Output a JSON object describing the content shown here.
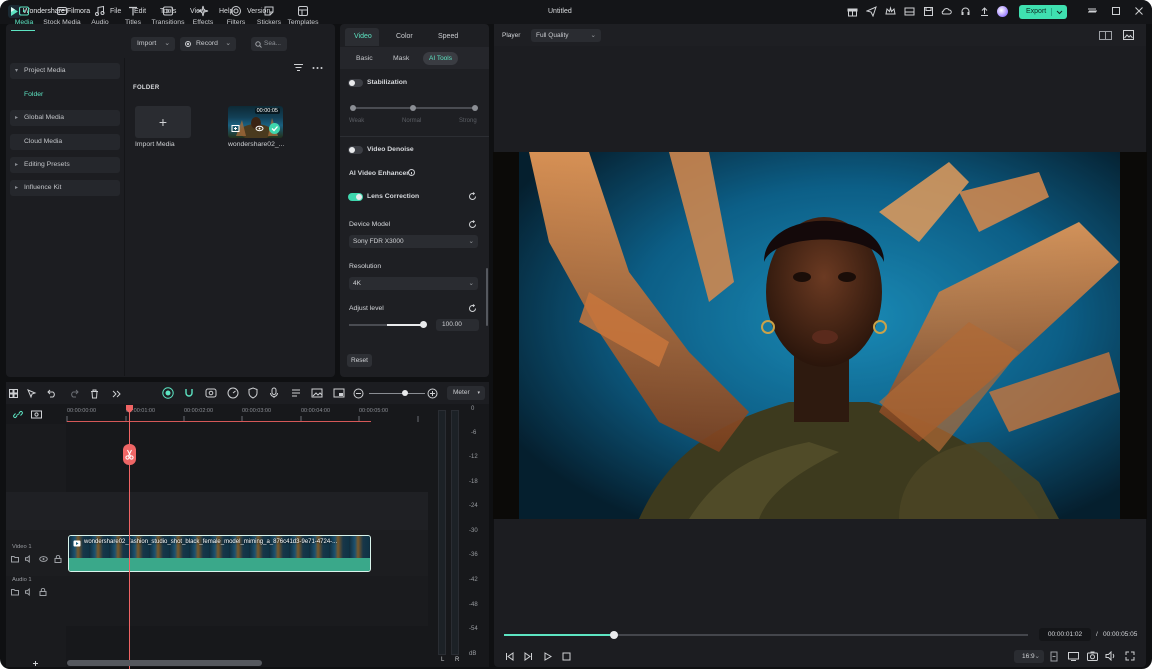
{
  "titlebar": {
    "app_name": "Wondershare Filmora",
    "menus": [
      "File",
      "Edit",
      "Tools",
      "View",
      "Help",
      "Version"
    ],
    "document_title": "Untitled",
    "export_label": "Export"
  },
  "media_tabs": [
    {
      "label": "Media",
      "icon": "media-icon"
    },
    {
      "label": "Stock Media",
      "icon": "stock-media-icon"
    },
    {
      "label": "Audio",
      "icon": "music-note-icon"
    },
    {
      "label": "Titles",
      "icon": "text-t-icon"
    },
    {
      "label": "Transitions",
      "icon": "transitions-icon"
    },
    {
      "label": "Effects",
      "icon": "sparkle-icon"
    },
    {
      "label": "Filters",
      "icon": "filter-icon"
    },
    {
      "label": "Stickers",
      "icon": "sticker-icon"
    },
    {
      "label": "Templates",
      "icon": "templates-icon"
    }
  ],
  "sidebar": {
    "project_media": "Project Media",
    "folder": "Folder",
    "global_media": "Global Media",
    "cloud_media": "Cloud Media",
    "editing_presets": "Editing Presets",
    "influence_kit": "Influence Kit"
  },
  "media_toolbar": {
    "import": "Import",
    "record": "Record",
    "search_placeholder": "Sea..."
  },
  "media_grid": {
    "folder_label": "FOLDER",
    "import_tile_label": "Import Media",
    "clip_label": "wondershare02_...",
    "clip_duration": "00:00:05"
  },
  "properties": {
    "tabs": [
      "Video",
      "Color",
      "Speed"
    ],
    "subtabs": [
      "Basic",
      "Mask",
      "AI Tools"
    ],
    "stabilization": "Stabilization",
    "stab_levels": [
      "Weak",
      "Normal",
      "Strong"
    ],
    "video_denoise": "Video Denoise",
    "ai_enhancer": "AI Video Enhancer",
    "lens_correction": "Lens Correction",
    "device_model_label": "Device Model",
    "device_model_value": "Sony FDR X3000",
    "resolution_label": "Resolution",
    "resolution_value": "4K",
    "adjust_label": "Adjust level",
    "adjust_value": "100.00",
    "reset": "Reset"
  },
  "player": {
    "label": "Player",
    "quality": "Full Quality",
    "current_time": "00:00:01:02",
    "separator": "/",
    "total_time": "00:00:05:05",
    "ratio": "16:9",
    "progress_fraction": 0.21
  },
  "timeline": {
    "meter_label": "Meter",
    "ticks": [
      "00:00:00:00",
      "00:00:01:00",
      "00:00:02:00",
      "00:00:03:00",
      "00:00:04:00",
      "00:00:05:00"
    ],
    "video_track": "Video 1",
    "audio_track": "Audio 1",
    "clip_name": "wondershare02_fashion_studio_shot_black_female_model_miming_a_876c41d3-9e71-4724-...",
    "db_labels": [
      "0",
      "-6",
      "-12",
      "-18",
      "-24",
      "-30",
      "-36",
      "-42",
      "-48",
      "-54",
      "dB"
    ],
    "vu_left": "L",
    "vu_right": "R"
  },
  "colors": {
    "accent": "#5de4c2",
    "export": "#3fe0b0",
    "playhead": "#f06464",
    "panel_bg": "#1c1d21"
  }
}
